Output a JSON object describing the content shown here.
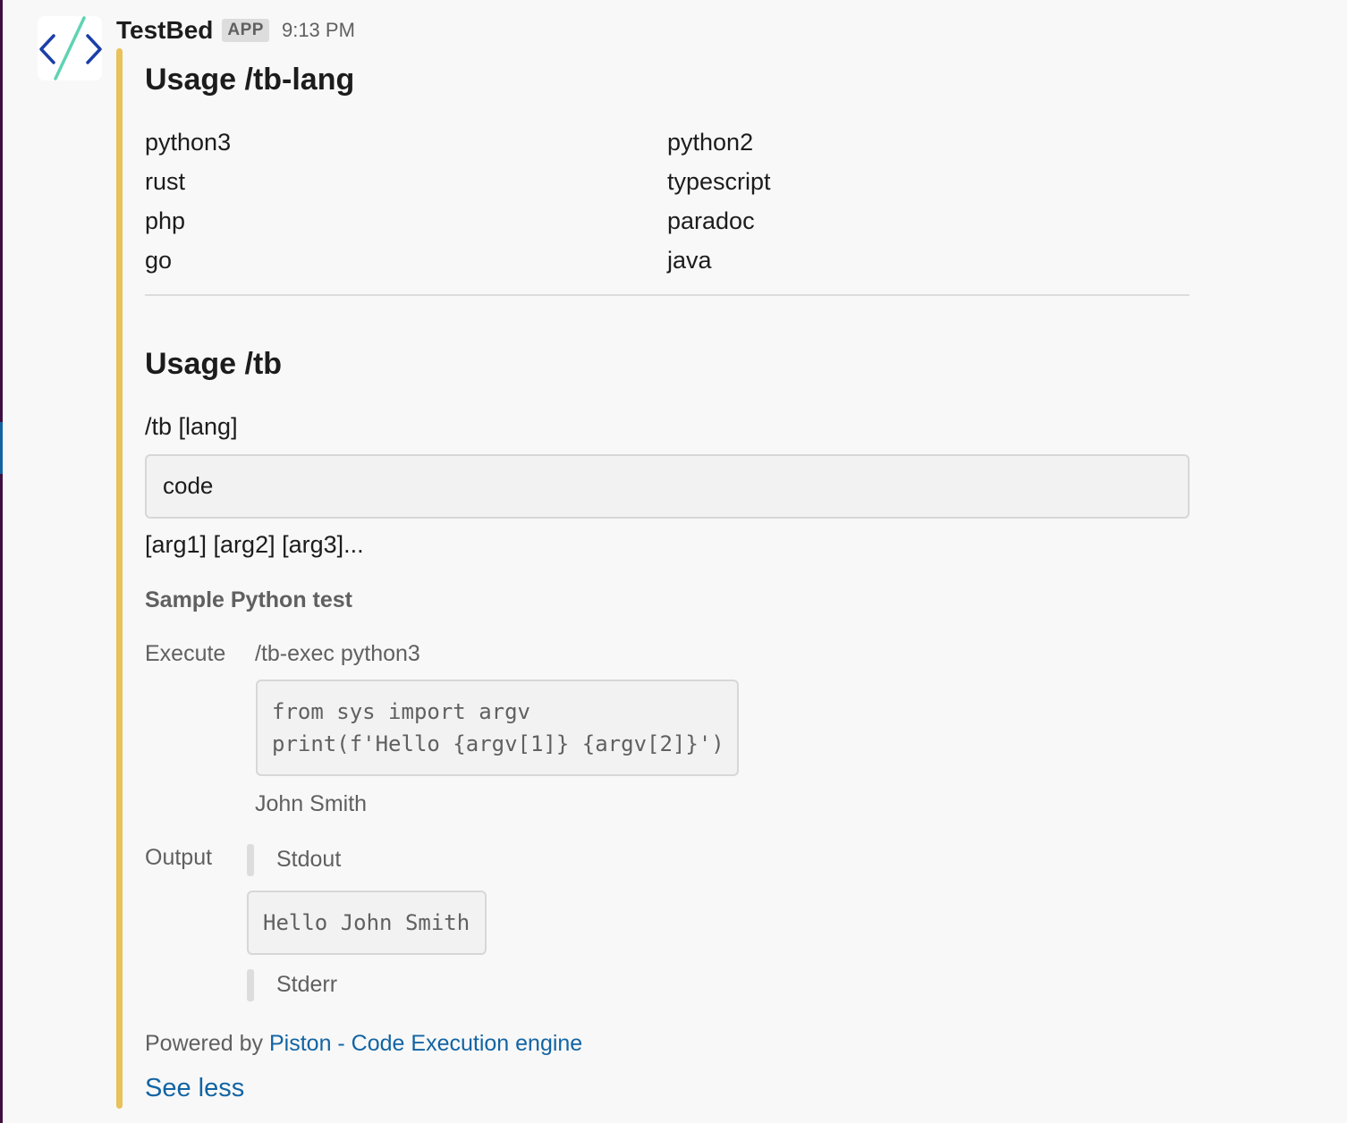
{
  "app": {
    "name": "TestBed",
    "badge": "APP",
    "timestamp": "9:13 PM",
    "accent_color": "#e8c25a"
  },
  "lang_section": {
    "title": "Usage /tb-lang",
    "languages_left": [
      "python3",
      "rust",
      "php",
      "go"
    ],
    "languages_right": [
      "python2",
      "typescript",
      "paradoc",
      "java"
    ]
  },
  "tb_section": {
    "title": "Usage /tb",
    "syntax": "/tb [lang]",
    "code_placeholder": "code",
    "args": "[arg1] [arg2] [arg3]..."
  },
  "sample": {
    "title": "Sample Python test",
    "execute_label": "Execute",
    "command": "/tb-exec python3",
    "code_lines": [
      "from sys import argv",
      "print(f'Hello {argv[1]} {argv[2]}')"
    ],
    "args": "John Smith",
    "output_label": "Output",
    "stdout_label": "Stdout",
    "stdout_value": "Hello John Smith",
    "stderr_label": "Stderr"
  },
  "footer": {
    "powered_by": "Powered by",
    "link_text": "Piston - Code Execution engine",
    "see_less": "See less"
  }
}
